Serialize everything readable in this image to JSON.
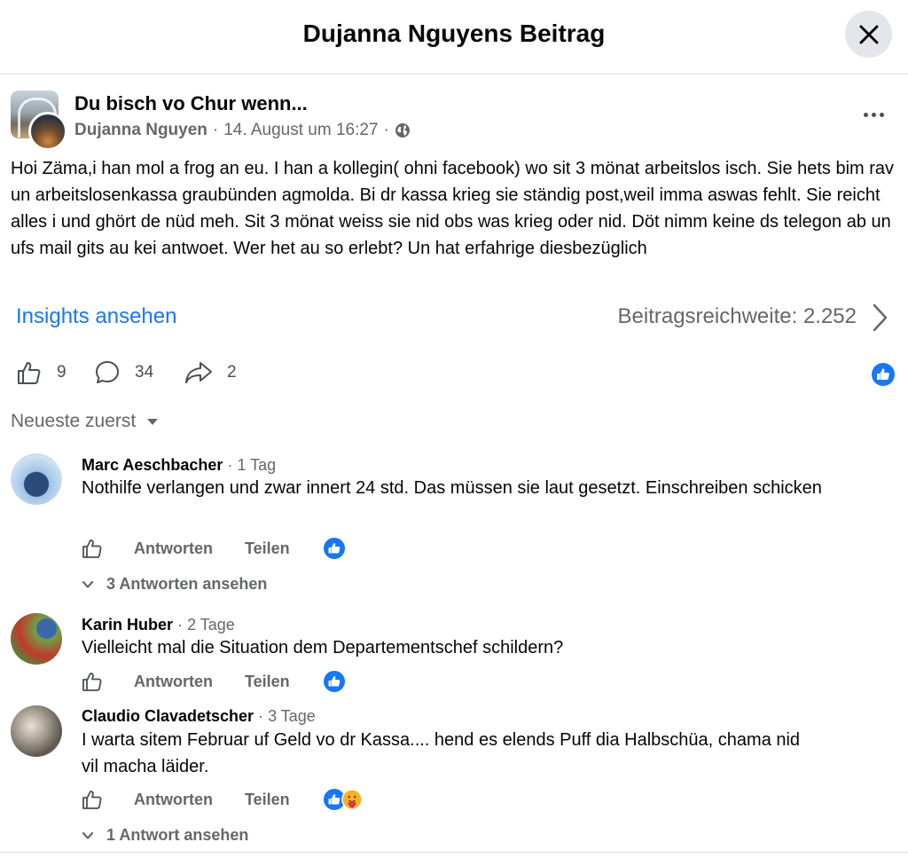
{
  "header": {
    "title": "Dujanna Nguyens Beitrag"
  },
  "post": {
    "group_name": "Du bisch vo Chur wenn...",
    "author": "Dujanna Nguyen",
    "timestamp": "14. August um 16:27",
    "separator": "·",
    "audience_icon": "globe-icon",
    "text": "Hoi Zäma,i han mol a frog an eu. I han a kollegin( ohni facebook) wo sit 3 mönat arbeitslos isch. Sie hets bim rav un arbeitslosenkassa graubünden agmolda. Bi dr kassa krieg sie ständig post,weil imma aswas fehlt. Sie reicht alles i und ghört de nüd meh. Sit 3 mönat weiss sie nid obs was krieg oder nid. Döt nimm keine ds telegon ab un ufs mail gits au kei antwoet. Wer het au so erlebt? Un hat erfahrige diesbezüglich"
  },
  "insights": {
    "link_label": "Insights ansehen",
    "reach_label": "Beitragsreichweite: 2.252"
  },
  "actions": {
    "likes": "9",
    "comments": "34",
    "shares": "2"
  },
  "sort": {
    "label": "Neueste zuerst"
  },
  "comments": [
    {
      "author": "Marc Aeschbacher",
      "time": "1 Tag",
      "text": "Nothilfe verlangen und zwar innert 24 std. Das müssen sie laut gesetzt. Einschreiben schicken",
      "reply_label": "Antworten",
      "share_label": "Teilen",
      "reactions": [
        "like"
      ],
      "replies_label": "3 Antworten ansehen"
    },
    {
      "author": "Karin Huber",
      "time": "2 Tage",
      "text": "Vielleicht mal die Situation dem Departementschef schildern?",
      "reply_label": "Antworten",
      "share_label": "Teilen",
      "reactions": [
        "like"
      ]
    },
    {
      "author": "Claudio Clavadetscher",
      "time": "3 Tage",
      "text": "I warta sitem Februar uf Geld vo dr Kassa.... hend es elends Puff dia Halbschüa, chama nid vil macha läider.",
      "reply_label": "Antworten",
      "share_label": "Teilen",
      "reactions": [
        "like",
        "care"
      ],
      "replies_label": "1 Antwort ansehen"
    }
  ],
  "colors": {
    "accent": "#1877f2",
    "secondary_text": "#65676b",
    "close_bg": "#e4e6eb"
  }
}
